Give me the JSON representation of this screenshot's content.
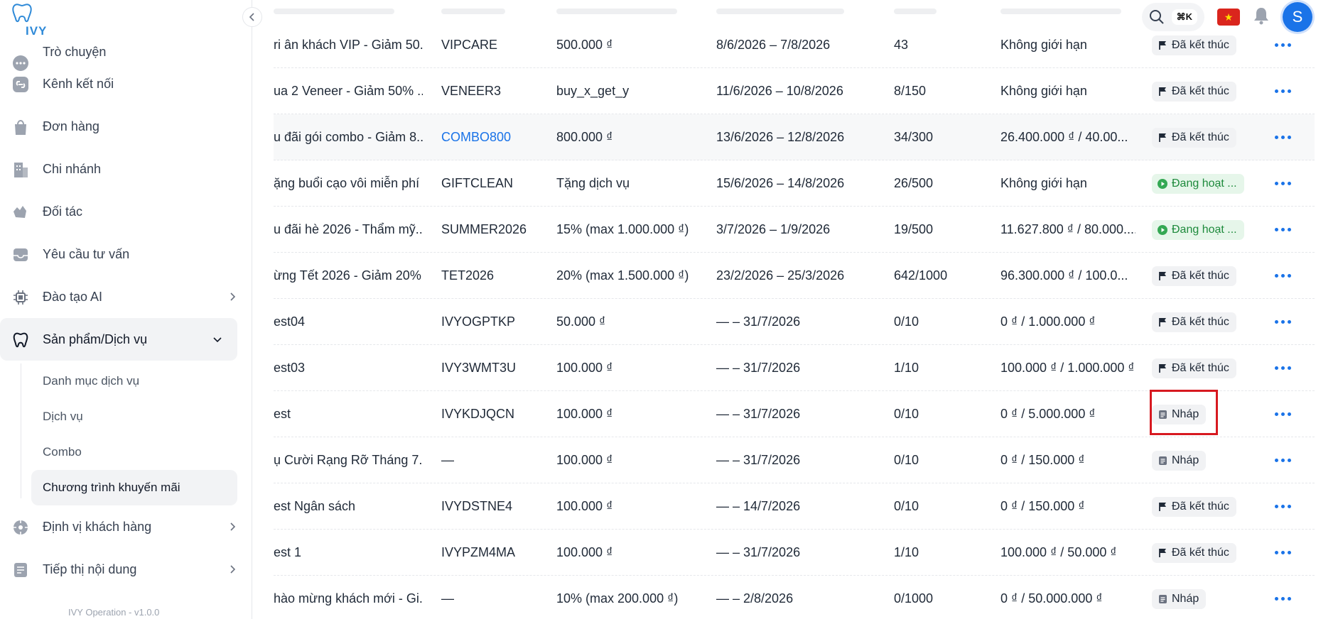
{
  "app": {
    "logo_text": "IVY",
    "version": "IVY Operation - v1.0.0"
  },
  "sidebar": {
    "items": [
      {
        "label": "Trò chuyện",
        "icon": "chat-bubble-icon"
      },
      {
        "label": "Kênh kết nối",
        "icon": "link-icon"
      },
      {
        "label": "Đơn hàng",
        "icon": "shopping-bag-icon"
      },
      {
        "label": "Chi nhánh",
        "icon": "building-icon"
      },
      {
        "label": "Đối tác",
        "icon": "handshake-icon"
      },
      {
        "label": "Yêu cầu tư vấn",
        "icon": "inbox-icon"
      },
      {
        "label": "Đào tạo AI",
        "icon": "chip-icon"
      },
      {
        "label": "Sản phẩm/Dịch vụ",
        "icon": "tooth-icon"
      }
    ],
    "sub_items": [
      {
        "label": "Danh mục dịch vụ"
      },
      {
        "label": "Dịch vụ"
      },
      {
        "label": "Combo"
      },
      {
        "label": "Chương trình khuyến mãi"
      }
    ],
    "items_after": [
      {
        "label": "Định vị khách hàng",
        "icon": "target-icon"
      },
      {
        "label": "Tiếp thị nội dung",
        "icon": "document-icon"
      }
    ]
  },
  "topbar": {
    "shortcut": "⌘K",
    "avatar_initial": "S",
    "flag_color": "#da251d"
  },
  "colors": {
    "accent": "#1a73e8",
    "active_badge_bg": "#e6f6ea",
    "active_badge_text": "#1e8a3c",
    "highlight": "#d71920"
  },
  "table": {
    "rows": [
      {
        "name": "ri ân khách VIP - Giảm 50...",
        "code": "VIPCARE",
        "value": "500.000 ₫",
        "period": "8/6/2026 – 7/8/2026",
        "used": "43",
        "budget": "Không giới hạn",
        "status": "Đã kết thúc",
        "status_type": "ended"
      },
      {
        "name": "ua 2 Veneer - Giảm 50% ...",
        "code": "VENEER3",
        "value": "buy_x_get_y",
        "period": "11/6/2026 – 10/8/2026",
        "used": "8/150",
        "budget": "Không giới hạn",
        "status": "Đã kết thúc",
        "status_type": "ended"
      },
      {
        "name": "u đãi gói combo - Giảm 8...",
        "code": "COMBO800",
        "value": "800.000 ₫",
        "period": "13/6/2026 – 12/8/2026",
        "used": "34/300",
        "budget": "26.400.000 ₫ / 40.00...",
        "status": "Đã kết thúc",
        "status_type": "ended"
      },
      {
        "name": "ặng buổi cạo vôi miễn phí",
        "code": "GIFTCLEAN",
        "value": "Tặng dịch vụ",
        "period": "15/6/2026 – 14/8/2026",
        "used": "26/500",
        "budget": "Không giới hạn",
        "status": "Đang hoạt ...",
        "status_type": "active"
      },
      {
        "name": "u đãi hè 2026 - Thẩm mỹ...",
        "code": "SUMMER2026",
        "value": "15% (max 1.000.000 ₫)",
        "period": "3/7/2026 – 1/9/2026",
        "used": "19/500",
        "budget": "11.627.800 ₫ / 80.000....",
        "status": "Đang hoạt ...",
        "status_type": "active"
      },
      {
        "name": "ừng Tết 2026 - Giảm 20%",
        "code": "TET2026",
        "value": "20% (max 1.500.000 ₫)",
        "period": "23/2/2026 – 25/3/2026",
        "used": "642/1000",
        "budget": "96.300.000 ₫ / 100.0...",
        "status": "Đã kết thúc",
        "status_type": "ended"
      },
      {
        "name": "est04",
        "code": "IVYOGPTKP",
        "value": "50.000 ₫",
        "period": "— – 31/7/2026",
        "used": "0/10",
        "budget": "0 ₫ / 1.000.000 ₫",
        "status": "Đã kết thúc",
        "status_type": "ended"
      },
      {
        "name": "est03",
        "code": "IVY3WMT3U",
        "value": "100.000 ₫",
        "period": "— – 31/7/2026",
        "used": "1/10",
        "budget": "100.000 ₫ / 1.000.000 ₫",
        "status": "Đã kết thúc",
        "status_type": "ended"
      },
      {
        "name": "est",
        "code": "IVYKDJQCN",
        "value": "100.000 ₫",
        "period": "— – 31/7/2026",
        "used": "0/10",
        "budget": "0 ₫ / 5.000.000 ₫",
        "status": "Nháp",
        "status_type": "draft"
      },
      {
        "name": "ụ Cười Rạng Rỡ Tháng 7...",
        "code": "—",
        "value": "100.000 ₫",
        "period": "— – 31/7/2026",
        "used": "0/10",
        "budget": "0 ₫ / 150.000 ₫",
        "status": "Nháp",
        "status_type": "draft"
      },
      {
        "name": "est Ngân sách",
        "code": "IVYDSTNE4",
        "value": "100.000 ₫",
        "period": "— – 14/7/2026",
        "used": "0/10",
        "budget": "0 ₫ / 150.000 ₫",
        "status": "Đã kết thúc",
        "status_type": "ended"
      },
      {
        "name": "est 1",
        "code": "IVYPZM4MA",
        "value": "100.000 ₫",
        "period": "— – 31/7/2026",
        "used": "1/10",
        "budget": "100.000 ₫ / 50.000 ₫",
        "status": "Đã kết thúc",
        "status_type": "ended"
      },
      {
        "name": "hào mừng khách mới - Gi...",
        "code": "—",
        "value": "10% (max 200.000 ₫)",
        "period": "— – 2/8/2026",
        "used": "0/1000",
        "budget": "0 ₫ / 50.000.000 ₫",
        "status": "Nháp",
        "status_type": "draft"
      }
    ]
  }
}
